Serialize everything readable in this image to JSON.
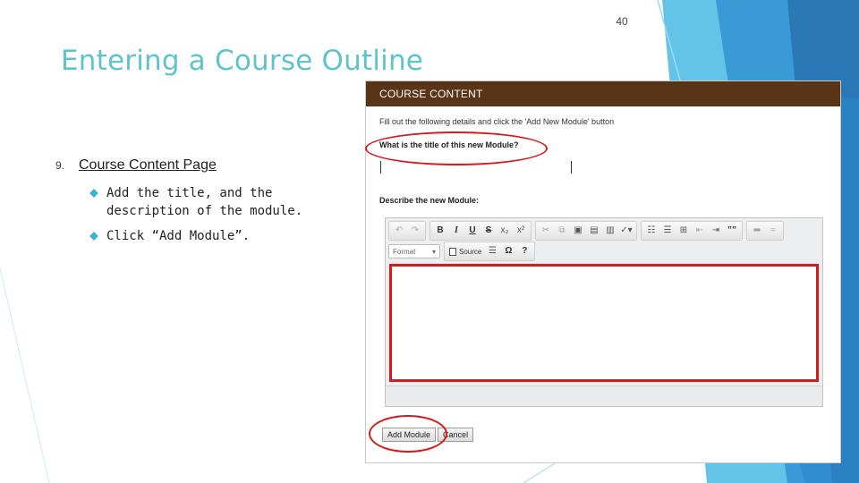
{
  "slide": {
    "page_number": "40",
    "title": "Entering a Course Outline",
    "step_number": "9.",
    "step_label": "Course Content Page",
    "bullets": [
      "Add the title, and the description of the module.",
      "Click “Add Module”."
    ],
    "accent_color": "#5fc3cc",
    "highlight_color": "#d8191b"
  },
  "screenshot": {
    "header": "COURSE CONTENT",
    "header_color": "#5a3416",
    "instruction": "Fill out the following details and click the 'Add New Module' button",
    "title_question": "What is the title of this new Module?",
    "title_value": "",
    "description_label": "Describe the new Module:",
    "description_value": "",
    "toolbar": {
      "bold": "B",
      "italic": "I",
      "underline": "U",
      "strike": "S",
      "subscript": "x₂",
      "superscript": "x²",
      "blockquote": "””",
      "format_label": "Format",
      "source_label": "Source",
      "special_char": "Ω",
      "help": "?"
    },
    "add_button": "Add Module",
    "cancel_button": "Cancel"
  }
}
